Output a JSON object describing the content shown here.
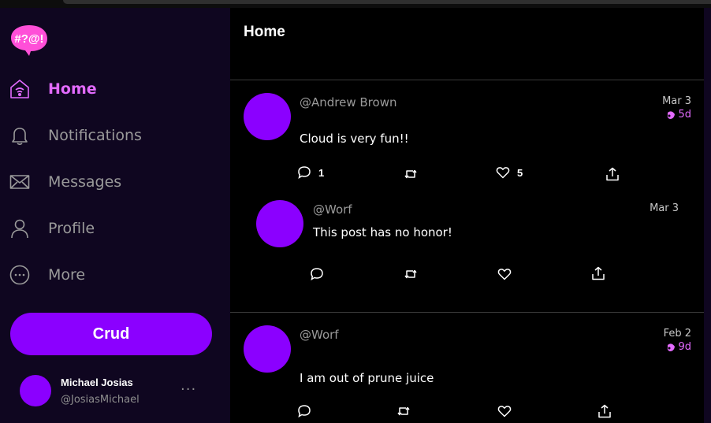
{
  "logo": {
    "text": "#?@!",
    "color": "#ff4fd8"
  },
  "nav": {
    "items": [
      {
        "label": "Home",
        "icon": "home-icon",
        "active": true
      },
      {
        "label": "Notifications",
        "icon": "bell-icon",
        "active": false
      },
      {
        "label": "Messages",
        "icon": "envelope-icon",
        "active": false
      },
      {
        "label": "Profile",
        "icon": "user-icon",
        "active": false
      },
      {
        "label": "More",
        "icon": "more-circle-icon",
        "active": false
      }
    ]
  },
  "compose": {
    "button_label": "Crud"
  },
  "profile": {
    "name": "Michael Josias",
    "handle": "@JosiasMichael",
    "more": "···"
  },
  "main": {
    "title": "Home"
  },
  "posts": [
    {
      "handle": "@Andrew Brown",
      "text": "Cloud is very fun!!",
      "date": "Mar 3",
      "age": "5d",
      "reply_count": "1",
      "like_count": "5",
      "reply": {
        "handle": "@Worf",
        "text": "This post has no honor!",
        "date": "Mar 3"
      }
    },
    {
      "handle": "@Worf",
      "text": "I am out of prune juice",
      "date": "Feb 2",
      "age": "9d"
    }
  ],
  "colors": {
    "accent": "#8b00ff",
    "active_nav": "#e36bff",
    "sidebar_bg": "#0f0620",
    "main_bg": "#000000"
  }
}
